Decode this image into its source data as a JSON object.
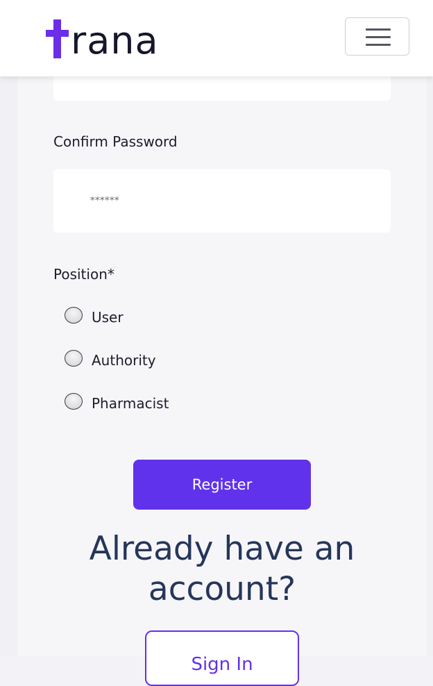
{
  "brand": {
    "logo_text": "rana",
    "accent_color": "#6132ec"
  },
  "nav": {
    "menu_icon": "hamburger-menu-icon"
  },
  "form": {
    "confirm_password": {
      "label": "Confirm Password",
      "placeholder": "******"
    },
    "position": {
      "label": "Position*",
      "options": [
        {
          "label": "User",
          "selected": false
        },
        {
          "label": "Authority",
          "selected": false
        },
        {
          "label": "Pharmacist",
          "selected": false
        }
      ]
    },
    "register_label": "Register"
  },
  "signin_section": {
    "heading": "Already have an account?",
    "button_label": "Sign In"
  }
}
